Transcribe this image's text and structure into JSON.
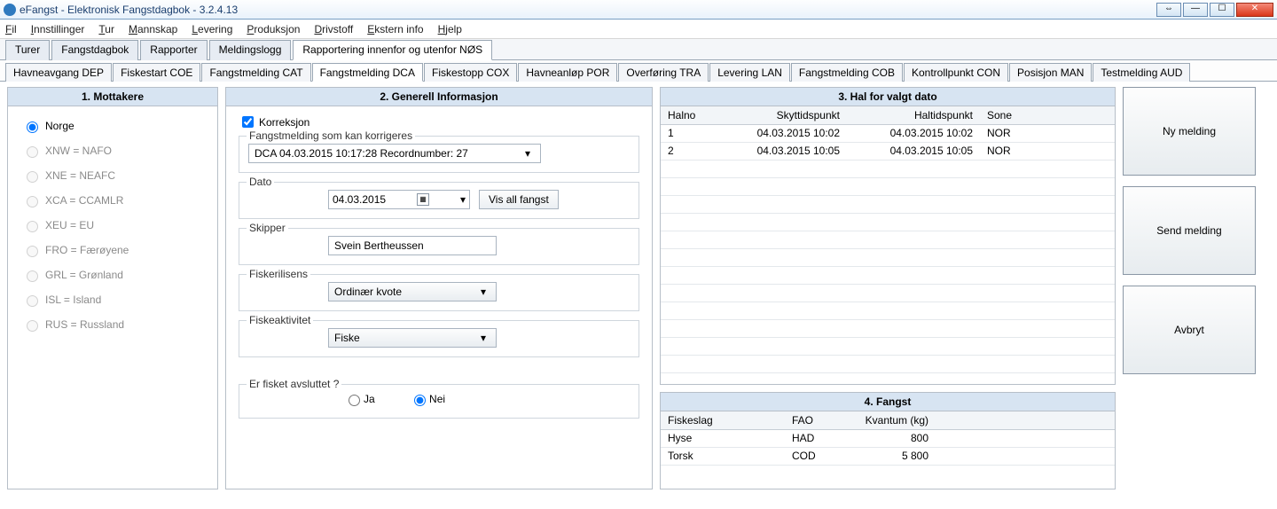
{
  "window": {
    "title": "eFangst - Elektronisk Fangstdagbok - 3.2.4.13"
  },
  "menu": [
    "Fil",
    "Innstillinger",
    "Tur",
    "Mannskap",
    "Levering",
    "Produksjon",
    "Drivstoff",
    "Ekstern info",
    "Hjelp"
  ],
  "mainTabs": [
    "Turer",
    "Fangstdagbok",
    "Rapporter",
    "Meldingslogg",
    "Rapportering innenfor og utenfor NØS"
  ],
  "mainTabActive": 4,
  "subTabs": [
    "Havneavgang DEP",
    "Fiskestart COE",
    "Fangstmelding CAT",
    "Fangstmelding DCA",
    "Fiskestopp COX",
    "Havneanløp POR",
    "Overføring TRA",
    "Levering LAN",
    "Fangstmelding COB",
    "Kontrollpunkt CON",
    "Posisjon MAN",
    "Testmelding AUD"
  ],
  "subTabActive": 3,
  "panel1": {
    "title": "1. Mottakere",
    "options": [
      {
        "label": "Norge",
        "enabled": true,
        "checked": true
      },
      {
        "label": "XNW = NAFO",
        "enabled": false
      },
      {
        "label": "XNE = NEAFC",
        "enabled": false
      },
      {
        "label": "XCA = CCAMLR",
        "enabled": false
      },
      {
        "label": "XEU = EU",
        "enabled": false
      },
      {
        "label": "FRO = Færøyene",
        "enabled": false
      },
      {
        "label": "GRL = Grønland",
        "enabled": false
      },
      {
        "label": "ISL = Island",
        "enabled": false
      },
      {
        "label": "RUS = Russland",
        "enabled": false
      }
    ]
  },
  "panel2": {
    "title": "2. Generell Informasjon",
    "korreksjon_label": "Korreksjon",
    "korreksjon_checked": true,
    "corr_label": "Fangstmelding som kan  korrigeres",
    "corr_value": "DCA 04.03.2015 10:17:28 Recordnumber: 27",
    "dato_label": "Dato",
    "dato_value": "04.03.2015",
    "vis_all_label": "Vis all fangst",
    "skipper_label": "Skipper",
    "skipper_value": "Svein Bertheussen",
    "fiskerilisens_label": "Fiskerilisens",
    "fiskerilisens_value": "Ordinær kvote",
    "fiskeaktivitet_label": "Fiskeaktivitet",
    "fiskeaktivitet_value": "Fiske",
    "avsluttet_label": "Er fisket avsluttet ?",
    "ja_label": "Ja",
    "nei_label": "Nei",
    "avsluttet_value": "Nei"
  },
  "panel3": {
    "title": "3. Hal for valgt dato",
    "cols": [
      "Halno",
      "Skyttidspunkt",
      "Haltidspunkt",
      "Sone"
    ],
    "rows": [
      {
        "halno": "1",
        "skytt": "04.03.2015 10:02",
        "hal": "04.03.2015 10:02",
        "sone": "NOR"
      },
      {
        "halno": "2",
        "skytt": "04.03.2015 10:05",
        "hal": "04.03.2015 10:05",
        "sone": "NOR"
      }
    ]
  },
  "panel4": {
    "title": "4. Fangst",
    "cols": [
      "Fiskeslag",
      "FAO",
      "Kvantum (kg)"
    ],
    "rows": [
      {
        "slag": "Hyse",
        "fao": "HAD",
        "kg": "800"
      },
      {
        "slag": "Torsk",
        "fao": "COD",
        "kg": "5 800"
      }
    ]
  },
  "actions": {
    "ny": "Ny melding",
    "send": "Send melding",
    "avbryt": "Avbryt"
  }
}
